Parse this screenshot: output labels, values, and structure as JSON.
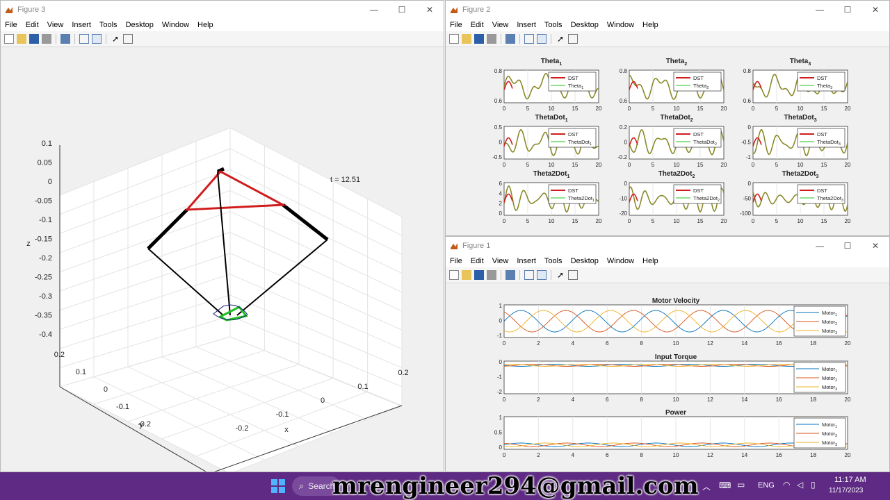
{
  "colors": {
    "taskbar": "#5e2a83",
    "red": "#d01c1c",
    "green": "#1fc11f",
    "black": "#000000",
    "blue": "#0072bd",
    "orange": "#d95319",
    "yellow": "#edb120"
  },
  "menus": [
    "File",
    "Edit",
    "View",
    "Insert",
    "Tools",
    "Desktop",
    "Window",
    "Help"
  ],
  "fig3": {
    "title": "Figure 3",
    "annotation": "t = 12.51",
    "z_ticks": [
      "0.1",
      "0.05",
      "0",
      "-0.05",
      "-0.1",
      "-0.15",
      "-0.2",
      "-0.25",
      "-0.3",
      "-0.35",
      "-0.4"
    ],
    "z_label": "z",
    "y_ticks": [
      "0.2",
      "0.1",
      "0",
      "-0.1",
      "-0.2"
    ],
    "y_label": "y",
    "x_ticks": [
      "-0.2",
      "-0.1",
      "0",
      "0.1",
      "0.2"
    ],
    "x_label": "x"
  },
  "fig2": {
    "title": "Figure 2",
    "plots": [
      {
        "title": "Theta",
        "sub": "1",
        "yticks": [
          "0.8",
          "0.6"
        ],
        "legend": [
          "DST",
          "Theta",
          "1"
        ]
      },
      {
        "title": "Theta",
        "sub": "2",
        "yticks": [
          "0.8",
          "0.6"
        ],
        "legend": [
          "DST",
          "Theta",
          "2"
        ]
      },
      {
        "title": "Theta",
        "sub": "3",
        "yticks": [
          "0.8",
          "0.6"
        ],
        "legend": [
          "DST",
          "Theta",
          "3"
        ]
      },
      {
        "title": "ThetaDot",
        "sub": "1",
        "yticks": [
          "0.5",
          "0",
          "-0.5"
        ],
        "legend": [
          "DST",
          "ThetaDot",
          "1"
        ]
      },
      {
        "title": "ThetaDot",
        "sub": "2",
        "yticks": [
          "0.2",
          "0",
          "-0.2"
        ],
        "legend": [
          "DST",
          "ThetaDot",
          "2"
        ]
      },
      {
        "title": "ThetaDot",
        "sub": "3",
        "yticks": [
          "0",
          "-0.5",
          "-1"
        ],
        "legend": [
          "DST",
          "ThetaDot",
          "3"
        ]
      },
      {
        "title": "Theta2Dot",
        "sub": "1",
        "yticks": [
          "6",
          "4",
          "2",
          "0"
        ],
        "legend": [
          "DST",
          "Theta2Dot",
          "1"
        ]
      },
      {
        "title": "Theta2Dot",
        "sub": "2",
        "yticks": [
          "0",
          "-10",
          "-20"
        ],
        "legend": [
          "DST",
          "Theta2Dot",
          "2"
        ]
      },
      {
        "title": "Theta2Dot",
        "sub": "3",
        "yticks": [
          "0",
          "-50",
          "-100"
        ],
        "legend": [
          "DST",
          "Theta2Dot",
          "3"
        ]
      }
    ],
    "xticks": [
      "0",
      "5",
      "10",
      "15",
      "20"
    ]
  },
  "fig1": {
    "title": "Figure 1",
    "plots": [
      {
        "title": "Motor Velocity",
        "yticks": [
          "1",
          "0",
          "-1"
        ]
      },
      {
        "title": "Input Torque",
        "yticks": [
          "0",
          "-1",
          "-2"
        ]
      },
      {
        "title": "Power",
        "yticks": [
          "1",
          "0.5",
          "0"
        ]
      }
    ],
    "legend_name": "Motor",
    "legend_subs": [
      "1",
      "2",
      "3"
    ],
    "xticks": [
      "0",
      "2",
      "4",
      "6",
      "8",
      "10",
      "12",
      "14",
      "16",
      "18",
      "20"
    ]
  },
  "taskbar": {
    "search_placeholder": "Search",
    "language": "ENG",
    "time": "11:17 AM",
    "date": "11/17/2023"
  },
  "overlay_email": "mrengineer294@gmail.com"
}
